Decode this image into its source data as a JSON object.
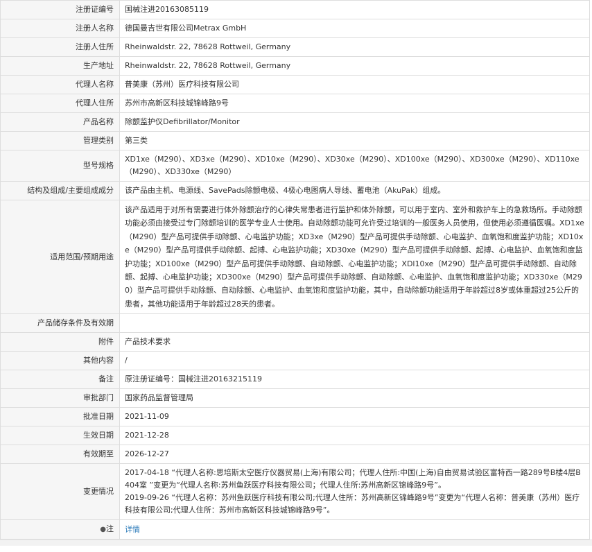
{
  "rows": [
    {
      "label": "注册证编号",
      "value": "国械注进20163085119"
    },
    {
      "label": "注册人名称",
      "value": "德国曼吉世有限公司Metrax GmbH"
    },
    {
      "label": "注册人住所",
      "value": "Rheinwaldstr. 22, 78628 Rottweil, Germany"
    },
    {
      "label": "生产地址",
      "value": "Rheinwaldstr. 22, 78628 Rottweil, Germany"
    },
    {
      "label": "代理人名称",
      "value": "普美康（苏州）医疗科技有限公司"
    },
    {
      "label": "代理人住所",
      "value": "苏州市高新区科技城锦峰路9号"
    },
    {
      "label": "产品名称",
      "value": "除颤监护仪Defibrillator/Monitor"
    },
    {
      "label": "管理类别",
      "value": "第三类"
    },
    {
      "label": "型号规格",
      "value": "XD1xe（M290）、XD3xe（M290）、XD10xe（M290）、XD30xe（M290）、XD100xe（M290）、XD300xe（M290）、XD110xe（M290）、XD330xe（M290）"
    },
    {
      "label": "结构及组成/主要组成成分",
      "value": "该产品由主机、电源线、SavePads除颤电极、4极心电图病人导线、蓄电池（AkuPak）组成。"
    },
    {
      "label": "适用范围/预期用途",
      "value": "该产品适用于对所有需要进行体外除颤治疗的心律失常患者进行监护和体外除颤，可以用于室内、室外和救护车上的急救场所。手动除颤功能必须由接受过专门除颤培训的医学专业人士使用。自动除颤功能可允许受过培训的一般医务人员使用，但使用必须遵循医嘱。XD1xe（M290）型产品可提供手动除颤、心电监护功能；XD3xe（M290）型产品可提供手动除颤、心电监护、血氧饱和度监护功能；XD10xe（M290）型产品可提供手动除颤、起搏、心电监护功能；XD30xe（M290）型产品可提供手动除颤、起搏、心电监护、血氧饱和度监护功能；XD100xe（M290）型产品可提供手动除颤、自动除颤、心电监护功能；XDl10xe（M290）型产品可提供手动除颤、自动除颤、起搏、心电监护功能；XD300xe（M290）型产品可提供手动除颤、自动除颤、心电监护、血氧饱和度监护功能；XD330xe（M290）型产品可提供手动除颤、自动除颤、心电监护、血氧饱和度监护功能，其中，自动除颤功能适用于年龄超过8岁或体重超过25公斤的患者，其他功能适用于年龄超过28天的患者。"
    },
    {
      "label": "产品储存条件及有效期",
      "value": ""
    },
    {
      "label": "附件",
      "value": "产品技术要求"
    },
    {
      "label": "其他内容",
      "value": "/"
    },
    {
      "label": "备注",
      "value": "原注册证编号：国械注进20163215119"
    },
    {
      "label": "审批部门",
      "value": "国家药品监督管理局"
    },
    {
      "label": "批准日期",
      "value": "2021-11-09"
    },
    {
      "label": "生效日期",
      "value": "2021-12-28"
    },
    {
      "label": "有效期至",
      "value": "2026-12-27"
    }
  ],
  "changes": {
    "label": "变更情况",
    "entries": [
      "2017-04-18 “代理人名称:思培斯太空医疗仪器贸易(上海)有限公司；代理人住所:中国(上海)自由贸易试验区富特西一路289号B楼4层B404室 ”变更为“代理人名称:苏州鱼跃医疗科技有限公司；代理人住所:苏州高新区锦峰路9号”。",
      "2019-09-26 “代理人名称：苏州鱼跃医疗科技有限公司;代理人住所：苏州高新区锦峰路9号”变更为“代理人名称：普美康（苏州）医疗科技有限公司;代理人住所：苏州市高新区科技城锦峰路9号”。"
    ]
  },
  "note": {
    "label": "注",
    "icon": "location-pin-icon",
    "link_text": "详情"
  }
}
